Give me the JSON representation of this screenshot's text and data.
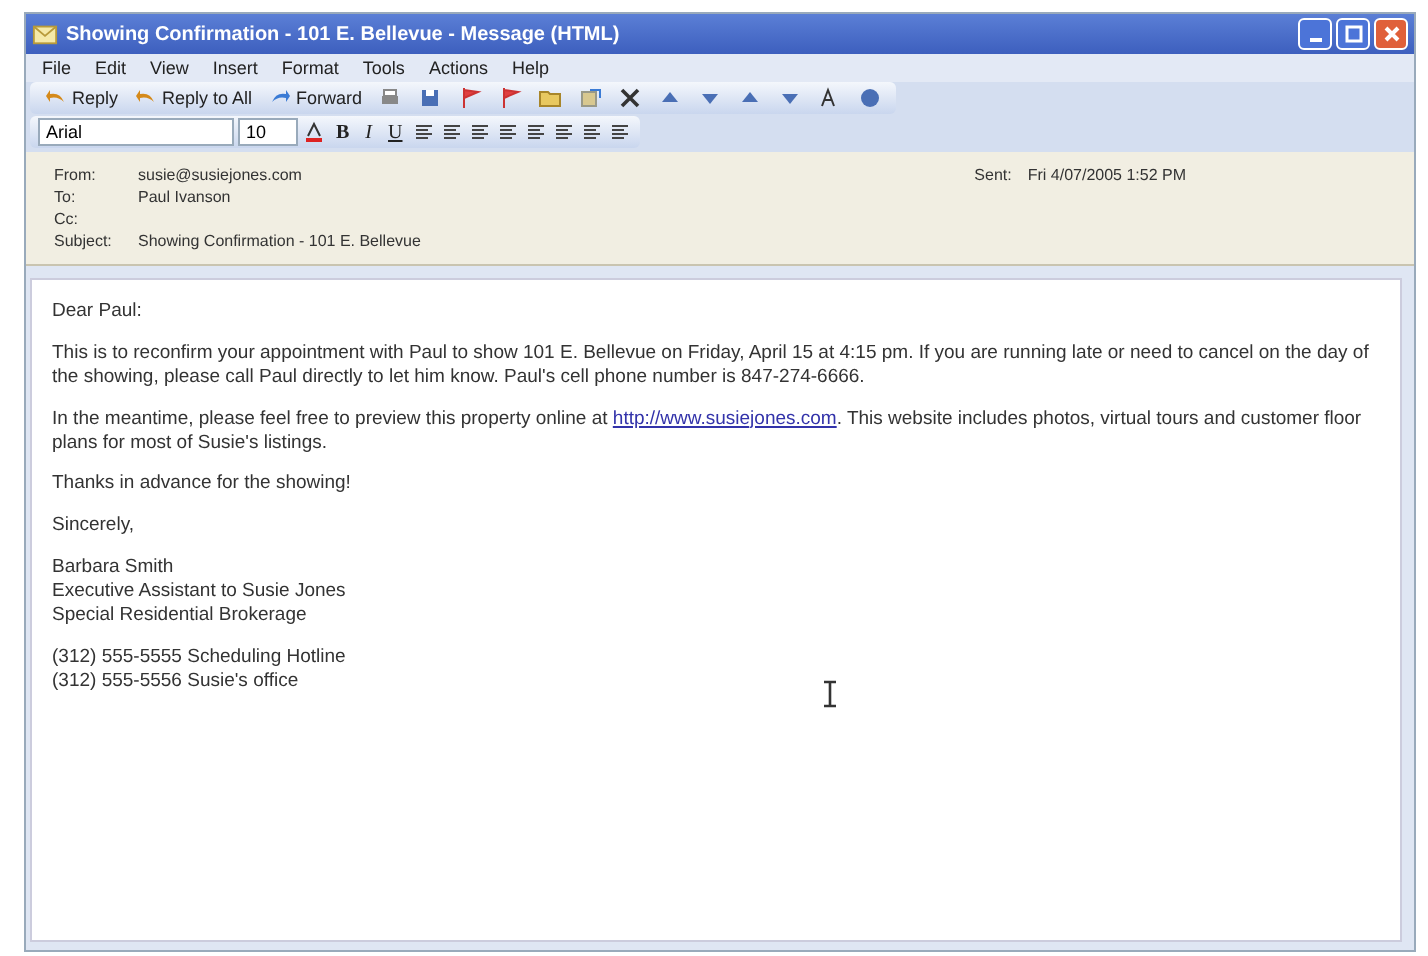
{
  "window": {
    "title": "Showing Confirmation - 101 E. Bellevue - Message (HTML)"
  },
  "menu": [
    "File",
    "Edit",
    "View",
    "Insert",
    "Format",
    "Tools",
    "Actions",
    "Help"
  ],
  "toolbar": [
    {
      "kind": "reply",
      "label": "Reply"
    },
    {
      "kind": "reply",
      "label": "Reply to All"
    },
    {
      "kind": "forward",
      "label": "Forward"
    },
    {
      "kind": "print"
    },
    {
      "kind": "save"
    },
    {
      "kind": "flag"
    },
    {
      "kind": "flag"
    },
    {
      "kind": "folder"
    },
    {
      "kind": "move"
    },
    {
      "kind": "delete"
    },
    {
      "kind": "up"
    },
    {
      "kind": "down"
    },
    {
      "kind": "up"
    },
    {
      "kind": "down"
    },
    {
      "kind": "font"
    },
    {
      "kind": "help"
    }
  ],
  "format_bar": {
    "font": "Arial",
    "size": "10",
    "buttons": [
      "B",
      "I",
      "U"
    ]
  },
  "header": {
    "from_label": "From:",
    "from": "susie@susiejones.com",
    "sent_label": "Sent:",
    "sent": "Fri 4/07/2005 1:52 PM",
    "to_label": "To:",
    "to": "Paul Ivanson",
    "cc_label": "Cc:",
    "subject_label": "Subject:",
    "subject": "Showing Confirmation - 101 E. Bellevue"
  },
  "body": {
    "greeting": "Dear Paul:",
    "paragraph_1": "This is to reconfirm your appointment with Paul to show 101 E. Bellevue on Friday, April 15 at 4:15 pm. If you are running late or need to cancel on the day of the showing, please call Paul directly to let him know. Paul's cell phone number is 847-274-6666.",
    "paragraph_2_before": "In the meantime, please feel free to preview this property online at",
    "link": "http://www.susiejones.com",
    "paragraph_2_after": ". This website includes photos, virtual tours and customer floor plans for most of Susie's listings.",
    "thanks": "Thanks in advance for the showing!",
    "closing": "Sincerely,",
    "signature": [
      "Barbara Smith",
      "Executive Assistant to Susie Jones",
      "Special Residential Brokerage"
    ],
    "phones": [
      "(312) 555-5555 Scheduling Hotline",
      "(312) 555-5556 Susie's office"
    ]
  }
}
